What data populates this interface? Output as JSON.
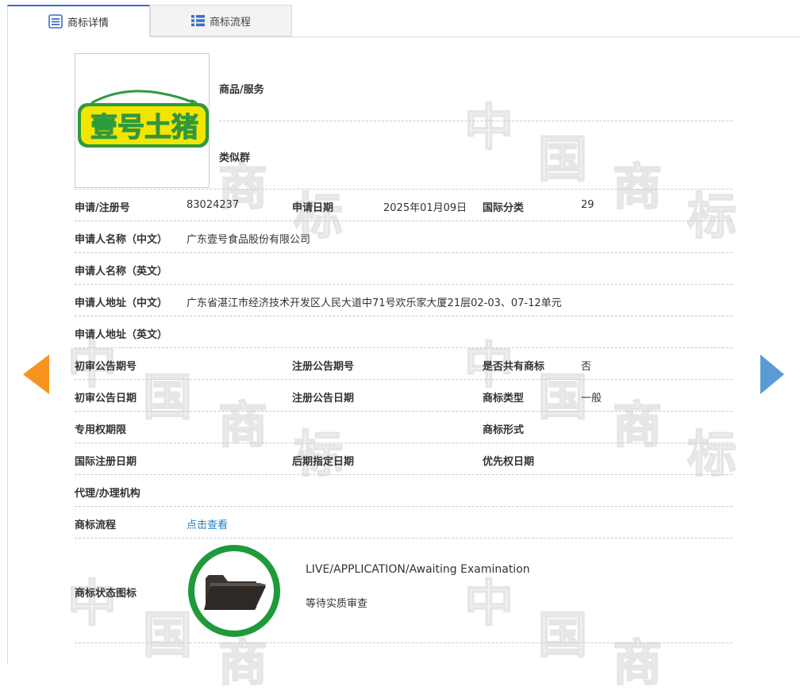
{
  "tabs": [
    {
      "label": "商标详情",
      "icon": "list-doc-icon"
    },
    {
      "label": "商标流程",
      "icon": "list-icon"
    }
  ],
  "watermark": {
    "chars": [
      "中",
      "国",
      "商",
      "标"
    ]
  },
  "logo": {
    "text": "壹号土猪",
    "colors": {
      "green": "#2e9a3e",
      "red": "#e63329",
      "yellow": "#f2e600"
    }
  },
  "goods": {
    "label": "商品/服务",
    "value": ""
  },
  "similar": {
    "label": "类似群",
    "value": ""
  },
  "rows": {
    "reg_no_label": "申请/注册号",
    "reg_no": "83024237",
    "app_date_label": "申请日期",
    "app_date": "2025年01月09日",
    "intl_class_label": "国际分类",
    "intl_class": "29",
    "applicant_cn_label": "申请人名称（中文）",
    "applicant_cn": "广东壹号食品股份有限公司",
    "applicant_en_label": "申请人名称（英文）",
    "applicant_en": "",
    "address_cn_label": "申请人地址（中文）",
    "address_cn": "广东省湛江市经济技术开发区人民大道中71号欢乐家大厦21层02-03、07-12单元",
    "address_en_label": "申请人地址（英文）",
    "address_en": "",
    "prelim_no_label": "初审公告期号",
    "reg_pub_no_label": "注册公告期号",
    "shared_label": "是否共有商标",
    "shared": "否",
    "prelim_date_label": "初审公告日期",
    "reg_pub_date_label": "注册公告日期",
    "type_label": "商标类型",
    "type": "一般",
    "exclusive_label": "专用权期限",
    "form_label": "商标形式",
    "intl_reg_date_label": "国际注册日期",
    "later_date_label": "后期指定日期",
    "priority_date_label": "优先权日期",
    "agent_label": "代理/办理机构",
    "process_label": "商标流程",
    "process_link": "点击查看",
    "status_icon_label": "商标状态图标"
  },
  "status": {
    "en": "LIVE/APPLICATION/Awaiting Examination",
    "cn": "等待实质审查",
    "icon": "folder-icon",
    "ring_color": "#1e9a3a"
  },
  "nav": {
    "prev": "arrow-left-icon",
    "next": "arrow-right-icon",
    "prev_color": "#f7941d",
    "next_color": "#5b9bd5"
  }
}
